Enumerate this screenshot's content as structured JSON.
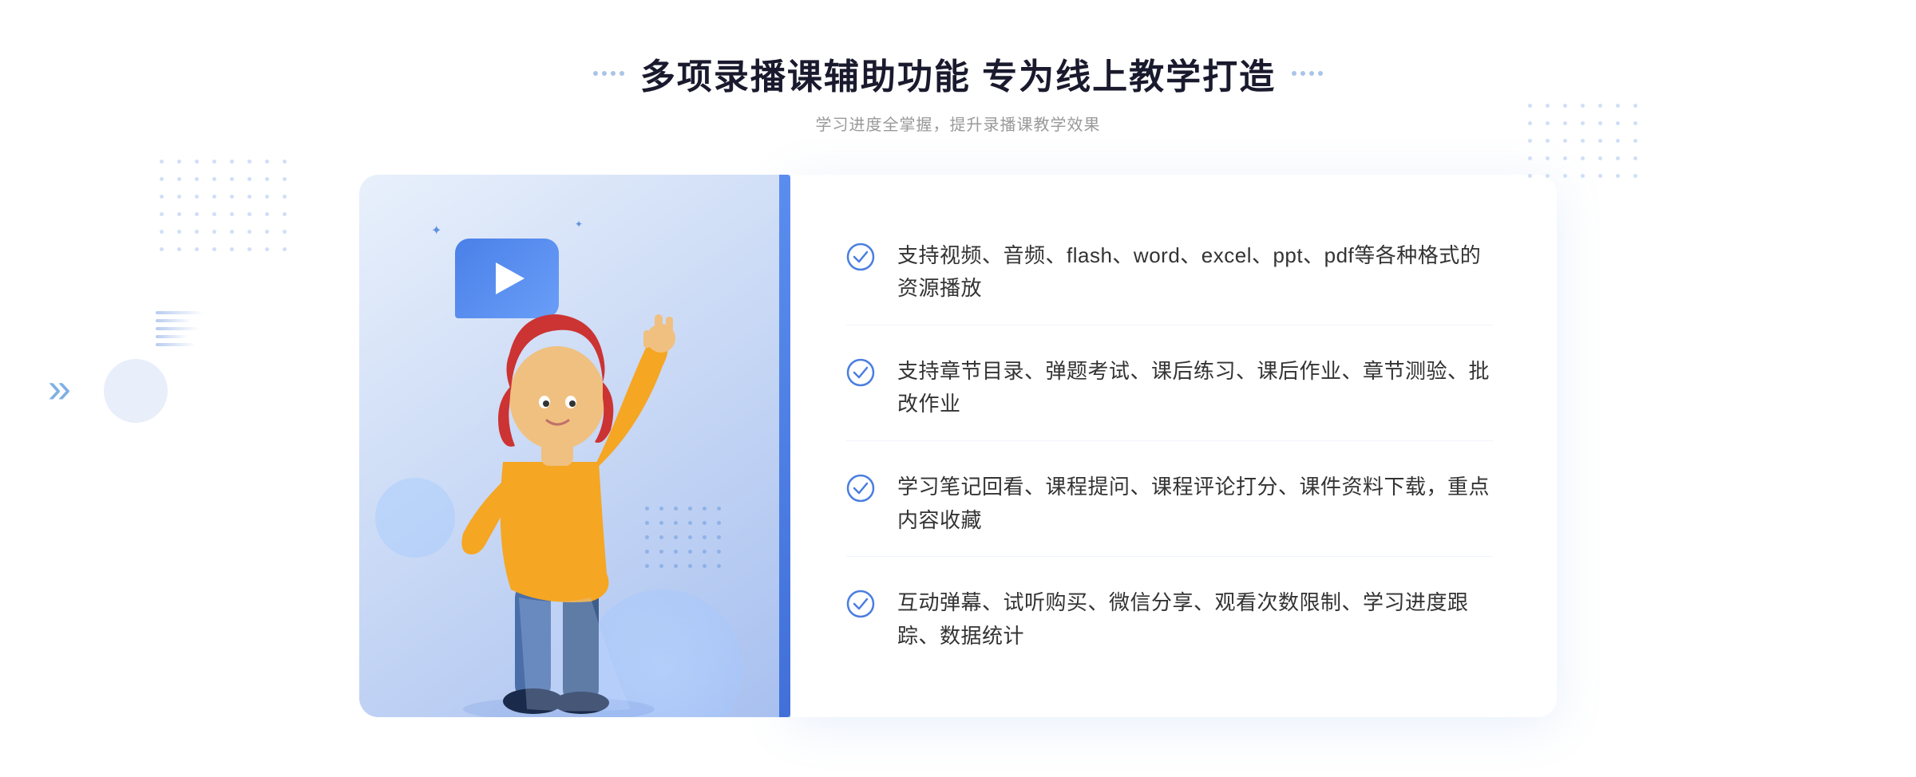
{
  "header": {
    "title": "多项录播课辅助功能 专为线上教学打造",
    "subtitle": "学习进度全掌握，提升录播课教学效果",
    "title_decorator_count": 4
  },
  "features": [
    {
      "id": 1,
      "text": "支持视频、音频、flash、word、excel、ppt、pdf等各种格式的资源播放"
    },
    {
      "id": 2,
      "text": "支持章节目录、弹题考试、课后练习、课后作业、章节测验、批改作业"
    },
    {
      "id": 3,
      "text": "学习笔记回看、课程提问、课程评论打分、课件资料下载，重点内容收藏"
    },
    {
      "id": 4,
      "text": "互动弹幕、试听购买、微信分享、观看次数限制、学习进度跟踪、数据统计"
    }
  ],
  "colors": {
    "primary_blue": "#4a7ee0",
    "light_blue": "#e8f0fb",
    "title_color": "#1a1a2e",
    "text_color": "#333333",
    "sub_color": "#999999",
    "check_color": "#4a7ee0"
  },
  "chevron": "»",
  "play_button_label": "play"
}
